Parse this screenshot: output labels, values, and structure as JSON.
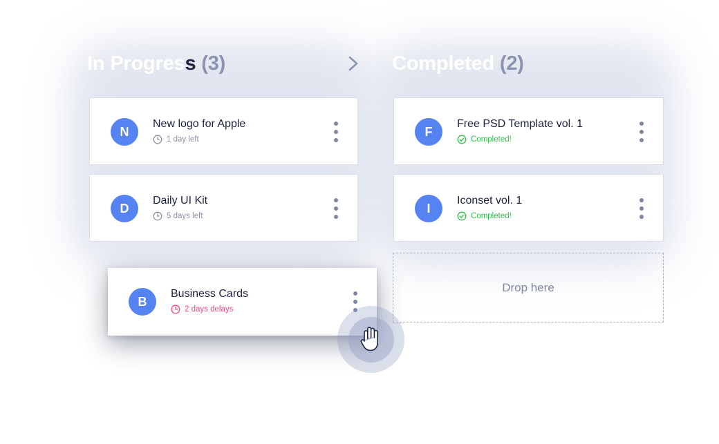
{
  "columns": {
    "in_progress": {
      "title_light": "In Progres",
      "title_dark": "s",
      "count": "(3)"
    },
    "completed": {
      "title": "Completed",
      "count": "(2)"
    }
  },
  "in_progress_cards": [
    {
      "initial": "N",
      "title": "New logo for Apple",
      "meta": "1 day left",
      "meta_icon": "clock-icon"
    },
    {
      "initial": "D",
      "title": "Daily UI Kit",
      "meta": "5 days left",
      "meta_icon": "clock-icon"
    }
  ],
  "dragging_card": {
    "initial": "B",
    "title": "Business Cards",
    "meta": "2 days delays",
    "meta_icon": "clock-icon"
  },
  "completed_cards": [
    {
      "initial": "F",
      "title": "Free PSD Template vol. 1",
      "meta": "Completed!",
      "meta_icon": "check-circle-icon"
    },
    {
      "initial": "I",
      "title": "Iconset vol. 1",
      "meta": "Completed!",
      "meta_icon": "check-circle-icon"
    }
  ],
  "dropzone": {
    "label": "Drop here"
  },
  "colors": {
    "avatar": "#5683f2",
    "completed": "#2fbf4c",
    "delayed": "#f0447a",
    "title_dark": "#1e2140",
    "muted": "#8a90a6"
  }
}
